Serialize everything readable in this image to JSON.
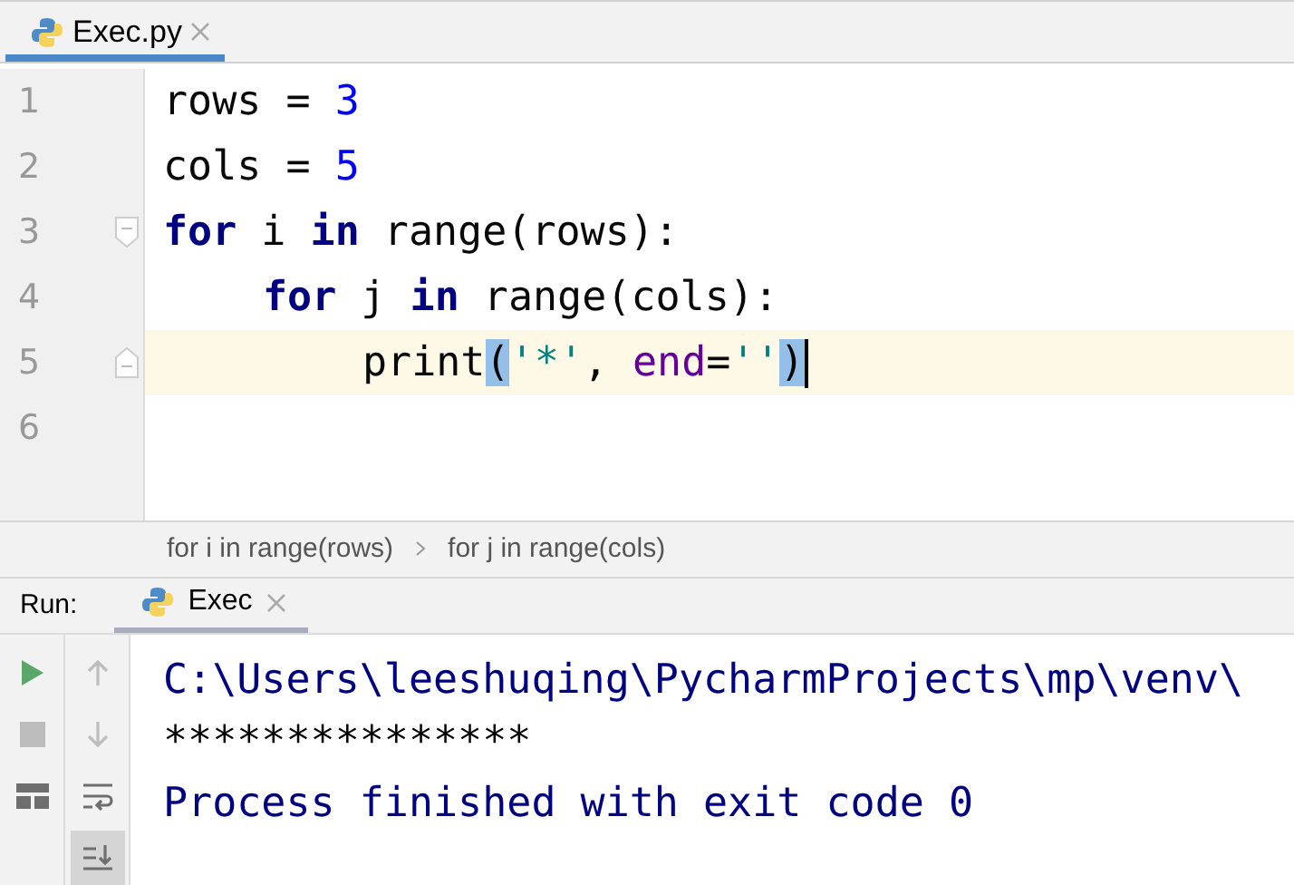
{
  "editor_tab": {
    "label": "Exec.py",
    "selected": true
  },
  "editor": {
    "lines": [
      {
        "number": "1",
        "current": false,
        "tokens": [
          {
            "kind": "plain",
            "text": "rows = "
          },
          {
            "kind": "number",
            "text": "3"
          }
        ]
      },
      {
        "number": "2",
        "current": false,
        "tokens": [
          {
            "kind": "plain",
            "text": "cols = "
          },
          {
            "kind": "number",
            "text": "5"
          }
        ]
      },
      {
        "number": "3",
        "current": false,
        "fold_start": true,
        "tokens": [
          {
            "kind": "keyword",
            "text": "for"
          },
          {
            "kind": "plain",
            "text": " i "
          },
          {
            "kind": "keyword",
            "text": "in"
          },
          {
            "kind": "plain",
            "text": " range(rows):"
          }
        ],
        "children": [
          {
            "number": "4",
            "current": false,
            "tokens": [
              {
                "kind": "keyword",
                "text": "for"
              },
              {
                "kind": "plain",
                "text": " j "
              },
              {
                "kind": "keyword",
                "text": "in"
              },
              {
                "kind": "plain",
                "text": " range(cols):"
              }
            ],
            "children": [
              {
                "number": "5",
                "current": true,
                "fold_end": true,
                "tokens": [
                  {
                    "kind": "plain",
                    "text": "print"
                  },
                  {
                    "kind": "bracket",
                    "text": "("
                  },
                  {
                    "kind": "string",
                    "text": "'*'"
                  },
                  {
                    "kind": "plain",
                    "text": ", "
                  },
                  {
                    "kind": "param",
                    "text": "end"
                  },
                  {
                    "kind": "plain",
                    "text": "="
                  },
                  {
                    "kind": "string",
                    "text": "''"
                  },
                  {
                    "kind": "bracket",
                    "text": ")"
                  }
                ]
              }
            ]
          }
        ]
      },
      {
        "number": "6",
        "current": false
      }
    ]
  },
  "breadcrumbs": [
    "for i in range(rows)",
    "for j in range(cols)"
  ],
  "run_panel": {
    "label": "Run:",
    "tab": {
      "label": "Exec",
      "selected": true
    },
    "tools": [
      [
        {
          "kind": "run",
          "disabled": false,
          "selected": false
        },
        {
          "kind": "stop",
          "disabled": true,
          "selected": false
        },
        {
          "kind": "layout",
          "disabled": false,
          "selected": false
        }
      ],
      [
        {
          "kind": "up",
          "disabled": true,
          "selected": false
        },
        {
          "kind": "down",
          "disabled": true,
          "selected": false
        },
        {
          "kind": "wrap",
          "disabled": false,
          "selected": false
        },
        {
          "kind": "scroll-end",
          "disabled": false,
          "selected": true
        }
      ]
    ],
    "console": [
      {
        "kind": "system",
        "text": "C:\\Users\\leeshuqing\\PycharmProjects\\mp\\venv\\"
      },
      {
        "kind": "output",
        "text": "***************"
      },
      {
        "kind": "system",
        "text": "Process finished with exit code 0"
      }
    ]
  }
}
